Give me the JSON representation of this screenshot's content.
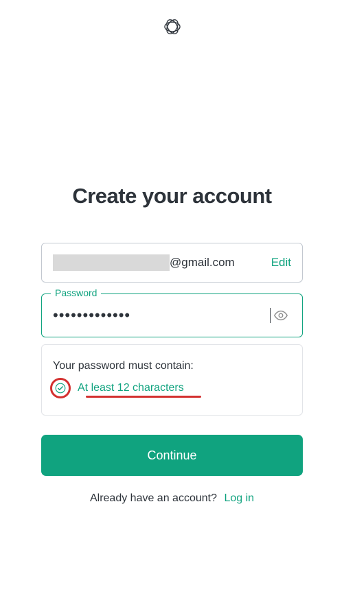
{
  "brand": {
    "name": "openai-logo"
  },
  "header": {
    "title": "Create your account"
  },
  "email": {
    "domain_suffix": "@gmail.com",
    "edit_label": "Edit"
  },
  "password": {
    "label": "Password",
    "masked_value": "•••••••••••••"
  },
  "requirements": {
    "heading": "Your password must contain:",
    "rule_min_chars": "At least 12 characters"
  },
  "actions": {
    "continue_label": "Continue"
  },
  "footer": {
    "prompt": "Already have an account?",
    "login_label": "Log in"
  },
  "colors": {
    "accent": "#10a37f",
    "annotation": "#d3302f"
  }
}
